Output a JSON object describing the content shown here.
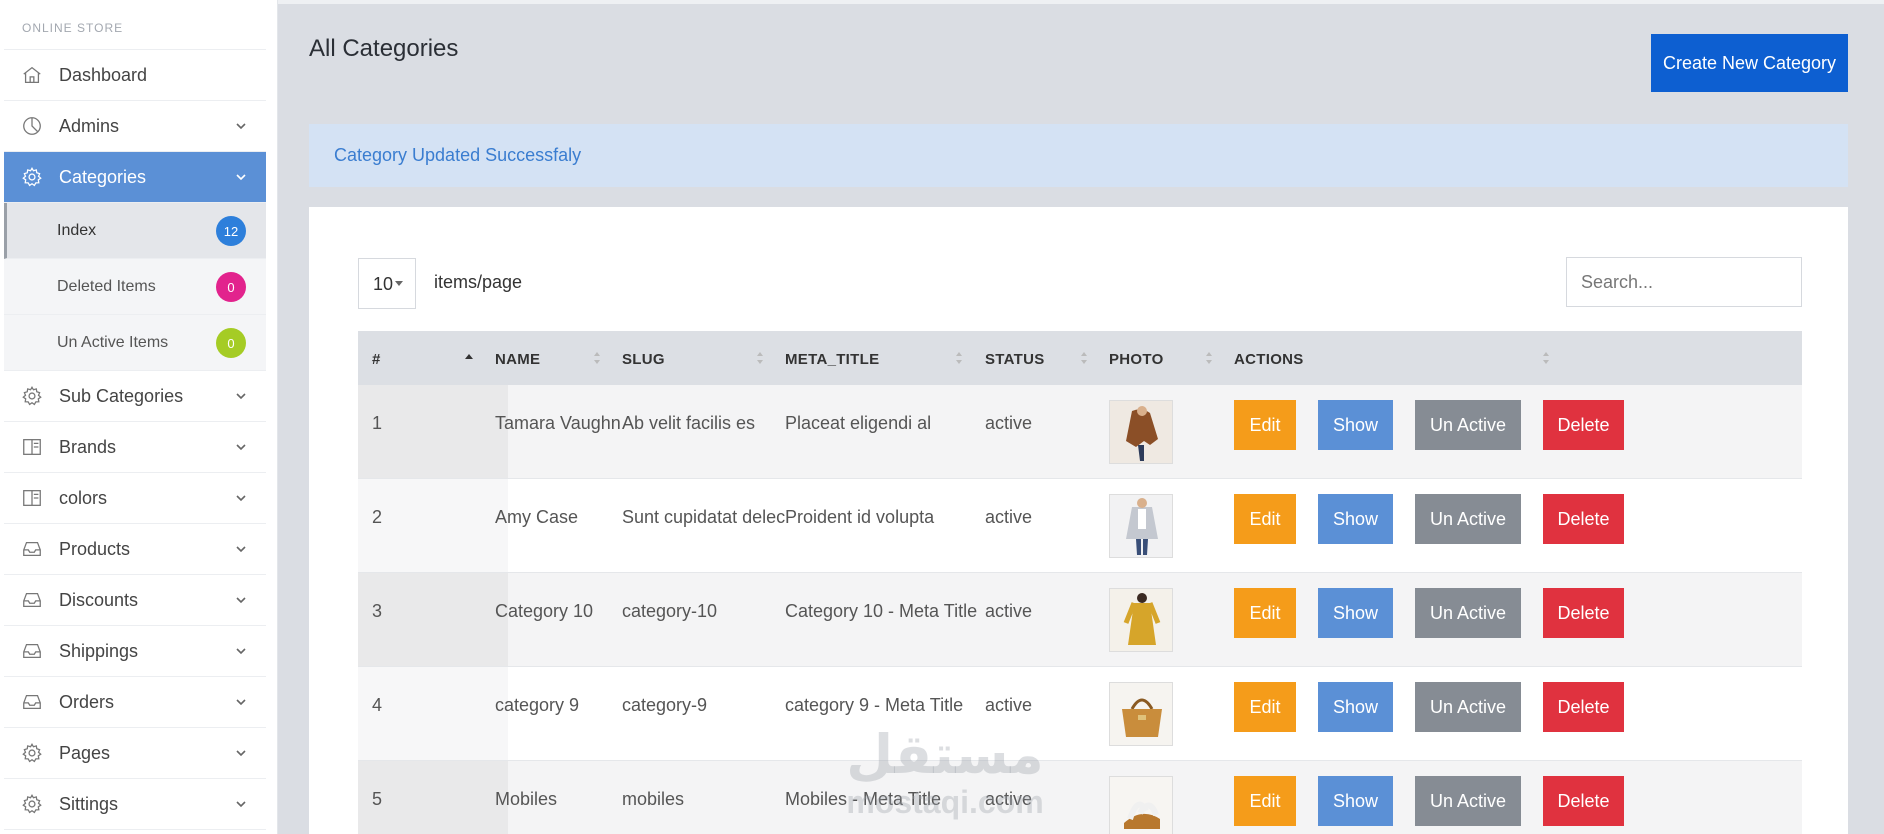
{
  "sidebar": {
    "brand": "ONLINE STORE",
    "items": [
      {
        "label": "Dashboard",
        "icon": "home-icon"
      },
      {
        "label": "Admins",
        "icon": "pie-chart-icon"
      },
      {
        "label": "Categories",
        "icon": "gear-icon"
      },
      {
        "label": "Sub Categories",
        "icon": "gear-icon"
      },
      {
        "label": "Brands",
        "icon": "columns-icon"
      },
      {
        "label": "colors",
        "icon": "columns-icon"
      },
      {
        "label": "Products",
        "icon": "inbox-icon"
      },
      {
        "label": "Discounts",
        "icon": "inbox-icon"
      },
      {
        "label": "Shippings",
        "icon": "inbox-icon"
      },
      {
        "label": "Orders",
        "icon": "inbox-icon"
      },
      {
        "label": "Pages",
        "icon": "gear-icon"
      },
      {
        "label": "Sittings",
        "icon": "gear-icon"
      }
    ],
    "subitems": [
      {
        "label": "Index",
        "count": "12",
        "color": "#2d7fdb"
      },
      {
        "label": "Deleted Items",
        "count": "0",
        "color": "#e2238d"
      },
      {
        "label": "Un Active Items",
        "count": "0",
        "color": "#a5cc25"
      }
    ]
  },
  "page": {
    "title": "All Categories",
    "create_label": "Create New Category",
    "alert": "Category Updated Successfaly"
  },
  "controls": {
    "per_page": "10",
    "per_page_label": "items/page",
    "search_placeholder": "Search..."
  },
  "table": {
    "headers": [
      "#",
      "NAME",
      "SLUG",
      "META_TITLE",
      "STATUS",
      "PHOTO",
      "ACTIONS"
    ],
    "actions": {
      "edit": "Edit",
      "show": "Show",
      "unactive": "Un Active",
      "delete": "Delete"
    },
    "rows": [
      {
        "id": "1",
        "name": "Tamara Vaughn",
        "slug": "Ab velit facilis es",
        "meta": "Placeat eligendi al",
        "status": "active",
        "photo": "brown-coat-photo"
      },
      {
        "id": "2",
        "name": "Amy Case",
        "slug": "Sunt cupidatat delec",
        "meta": "Proident id volupta",
        "status": "active",
        "photo": "grey-coat-photo"
      },
      {
        "id": "3",
        "name": "Category 10",
        "slug": "category-10",
        "meta": "Category 10 - Meta Title",
        "status": "active",
        "photo": "yellow-dress-photo"
      },
      {
        "id": "4",
        "name": "category 9",
        "slug": "category-9",
        "meta": "category 9 - Meta Title",
        "status": "active",
        "photo": "handbag-photo"
      },
      {
        "id": "5",
        "name": "Mobiles",
        "slug": "mobiles",
        "meta": "Mobiles - Meta Title",
        "status": "active",
        "photo": "sandal-photo"
      }
    ]
  },
  "watermark": {
    "arabic": "مستقل",
    "latin": "mostaqi.com"
  },
  "colors": {
    "accent": "#5b90d6",
    "primary": "#0d5fd1",
    "edit": "#f59c1a",
    "unactive": "#868c94",
    "delete": "#e0323f"
  }
}
